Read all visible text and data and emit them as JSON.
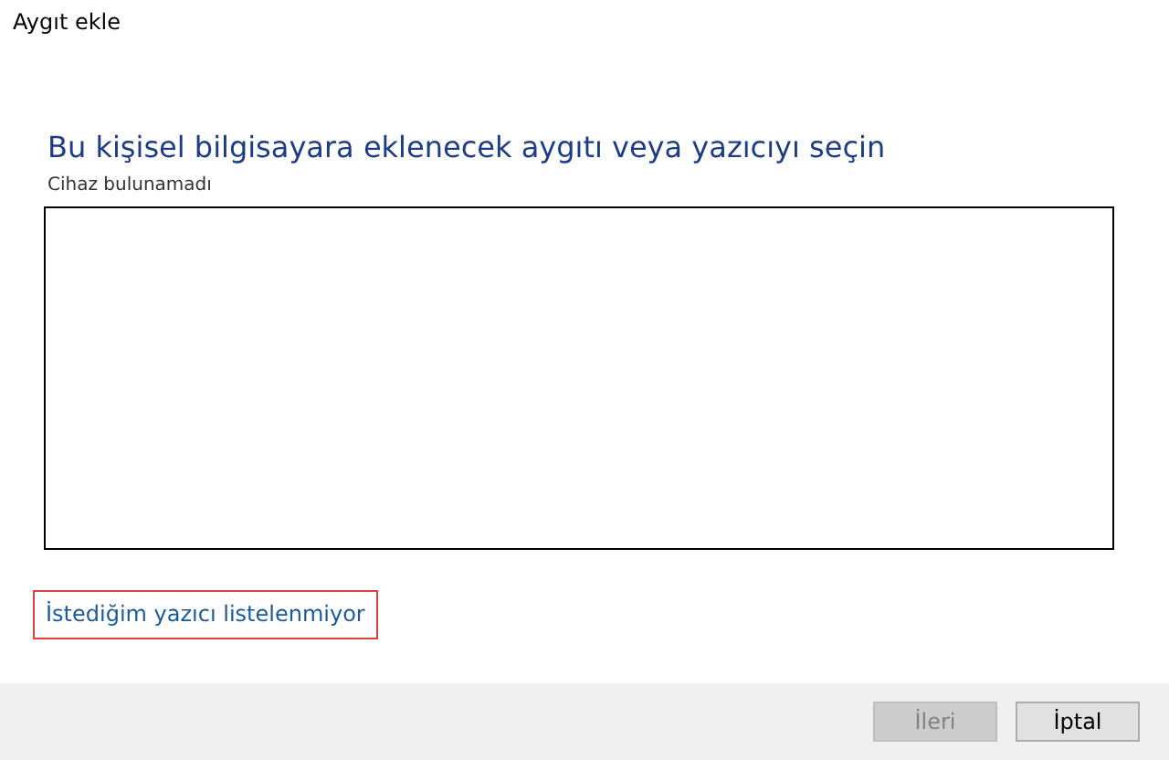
{
  "window": {
    "title": "Aygıt ekle"
  },
  "heading": "Bu kişisel bilgisayara eklenecek aygıtı veya yazıcıyı seçin",
  "status": "Cihaz bulunamadı",
  "link": {
    "label": "İstediğim yazıcı listelenmiyor",
    "highlighted": true
  },
  "buttons": [
    {
      "label": "İleri",
      "disabled": true
    },
    {
      "label": "İptal",
      "disabled": false
    }
  ]
}
